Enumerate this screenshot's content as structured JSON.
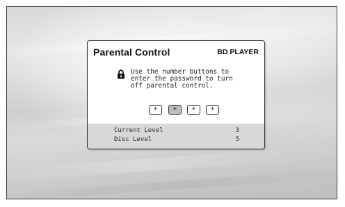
{
  "dialog": {
    "title": "Parental Control",
    "device_label": "BD PLAYER",
    "message": "Use the number buttons to\nenter the password to turn\noff parental control.",
    "lock_icon": "lock-icon",
    "password_digits": [
      "*",
      "*",
      "*",
      "*"
    ],
    "active_digit_index": 1,
    "info": [
      {
        "label": "Current Level",
        "value": "3"
      },
      {
        "label": "Disc Level",
        "value": "5"
      }
    ]
  },
  "colors": {
    "dialog_background": "#ffffff",
    "info_panel_background": "#d8d8d8",
    "active_digit_background": "#bdbdbd",
    "screen_background": "#d6d6d6"
  }
}
